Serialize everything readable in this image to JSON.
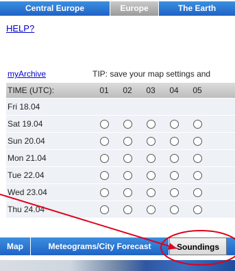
{
  "top_tabs": [
    "Central Europe",
    "Europe",
    "The Earth"
  ],
  "help_link": "HELP?",
  "archive_link": "myArchive",
  "tip": "TIP: save your map settings and",
  "time_header": "TIME (UTC):",
  "hours": [
    "01",
    "02",
    "03",
    "04",
    "05"
  ],
  "days": [
    {
      "label": "Fri 18.04",
      "has_radios": false
    },
    {
      "label": "Sat 19.04",
      "has_radios": true
    },
    {
      "label": "Sun 20.04",
      "has_radios": true
    },
    {
      "label": "Mon 21.04",
      "has_radios": true
    },
    {
      "label": "Tue 22.04",
      "has_radios": true
    },
    {
      "label": "Wed 23.04",
      "has_radios": true
    },
    {
      "label": "Thu 24.04",
      "has_radios": true
    }
  ],
  "bottom_tabs": [
    "Map",
    "Meteograms/City Forecast",
    "Soundings",
    ""
  ],
  "colors": {
    "tab_blue": "#1f63c6",
    "annotation_red": "#e0001a",
    "link": "#0000cc"
  }
}
